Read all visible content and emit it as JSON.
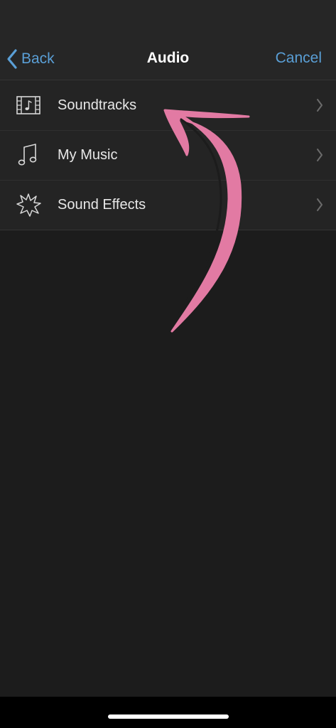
{
  "nav": {
    "back_label": "Back",
    "title": "Audio",
    "cancel_label": "Cancel"
  },
  "items": [
    {
      "label": "Soundtracks",
      "icon": "film-music-icon"
    },
    {
      "label": "My Music",
      "icon": "music-note-icon"
    },
    {
      "label": "Sound Effects",
      "icon": "starburst-icon"
    }
  ],
  "colors": {
    "accent": "#5a9fd6",
    "background": "#1c1c1c",
    "annotation": "#e27aa3"
  }
}
